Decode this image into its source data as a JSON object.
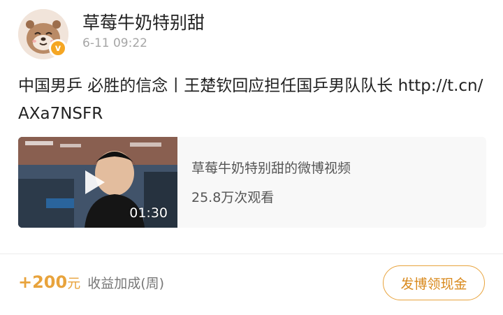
{
  "post": {
    "username": "草莓牛奶特别甜",
    "timestamp": "6-11 09:22",
    "verified_badge": "v",
    "text": "中国男乒 必胜的信念丨王楚钦回应担任国乒男队队长 http://t.cn/AXa7NSFR"
  },
  "video_card": {
    "title": "草莓牛奶特别甜的微博视频",
    "views": "25.8万次观看",
    "duration": "01:30"
  },
  "footer": {
    "reward_amount": "+200",
    "reward_unit": "元",
    "reward_label": "收益加成(周)",
    "cash_button_label": "发博领现金"
  },
  "colors": {
    "accent": "#e8a33c",
    "username": "#222222",
    "timestamp": "#a6a6a6",
    "card_bg": "#f8f8f8"
  },
  "icons": {
    "avatar": "otter-avatar",
    "verified": "verified-badge-icon",
    "play": "play-icon"
  }
}
